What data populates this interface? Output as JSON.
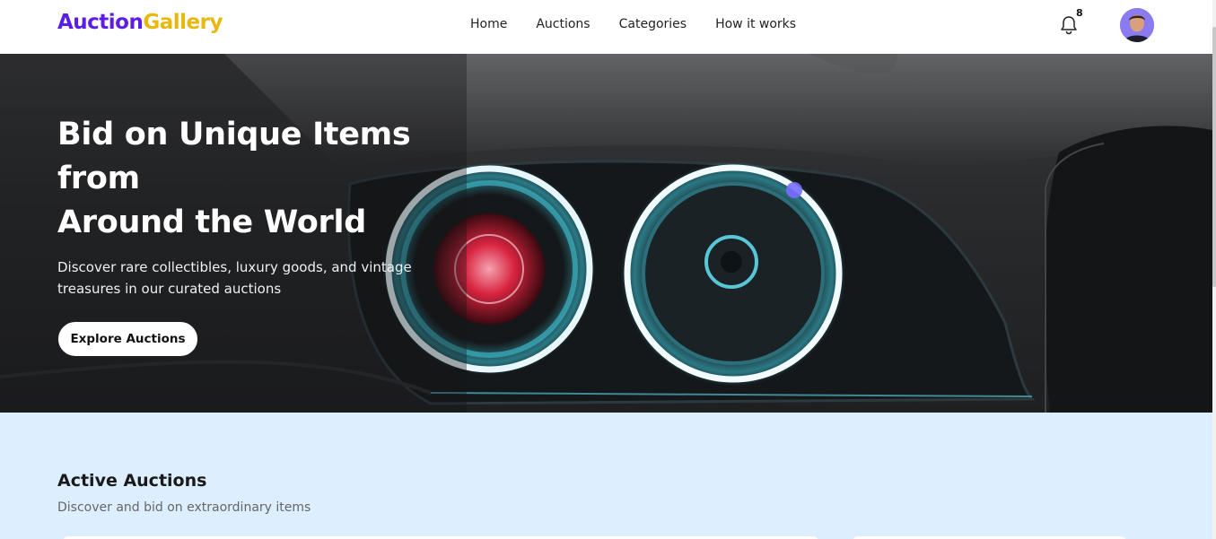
{
  "header": {
    "logo_part1": "Auction",
    "logo_part2": "Gallery",
    "nav": [
      "Home",
      "Auctions",
      "Categories",
      "How it works"
    ],
    "notification_count": "8",
    "icons": {
      "notifications": "bell-icon",
      "profile": "user-avatar"
    }
  },
  "hero": {
    "title_line1": "Bid on Unique Items",
    "title_line2": "from",
    "title_line3": "Around the World",
    "subtitle": "Discover rare collectibles, luxury goods, and vintage treasures in our curated auctions",
    "cta_label": "Explore Auctions"
  },
  "active_auctions": {
    "title": "Active Auctions",
    "subtitle": "Discover and bid on extraordinary items"
  },
  "colors": {
    "logo_primary": "#5b1ee6",
    "logo_accent": "#e8b80f",
    "section_bg": "#ddeeff",
    "hero_bg": "#2a2b2d"
  }
}
